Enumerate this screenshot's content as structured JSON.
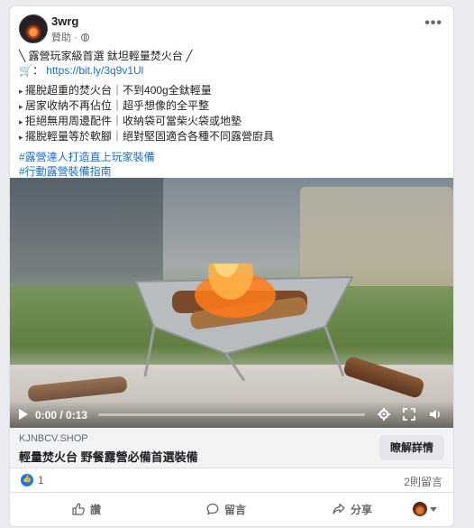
{
  "post": {
    "page_name": "3wrg",
    "sponsored_label": "贊助 ·",
    "more_label": "•••",
    "body": {
      "headline": "╲ 露營玩家級首選 鈦坦輕量焚火台 ╱",
      "link_prefix": "🛒：",
      "link_text": "https://bit.ly/3q9v1Ul",
      "bullets": [
        "擺脫超重的焚火台｜不到400g全鈦輕量",
        "居家收納不再佔位｜超乎想像的全平整",
        "拒絕無用周邊配件｜收納袋可當柴火袋或地墊",
        "擺脫輕量等於軟腳｜絕對堅固適合各種不同露營廚具"
      ],
      "hashtags": [
        "#露營達人打造直上玩家裝備",
        "#行動露營裝備指南"
      ]
    },
    "video": {
      "time": "0:00 / 0:13",
      "progress": 0.0,
      "settings_icon": "gear-icon",
      "fullscreen_icon": "fullscreen-icon",
      "volume_icon": "volume-icon"
    },
    "link_preview": {
      "domain": "KJNBCV.SHOP",
      "title": "輕量焚火台 野餐露營必備首選裝備",
      "button": "瞭解詳情"
    },
    "stats": {
      "likes": "1",
      "comments": "2則留言"
    },
    "actions": {
      "like": "讚",
      "comment": "留言",
      "share": "分享"
    }
  },
  "colors": {
    "link": "#1a6ed8",
    "like_blue": "#1877f2",
    "secondary_text": "#65676b"
  }
}
